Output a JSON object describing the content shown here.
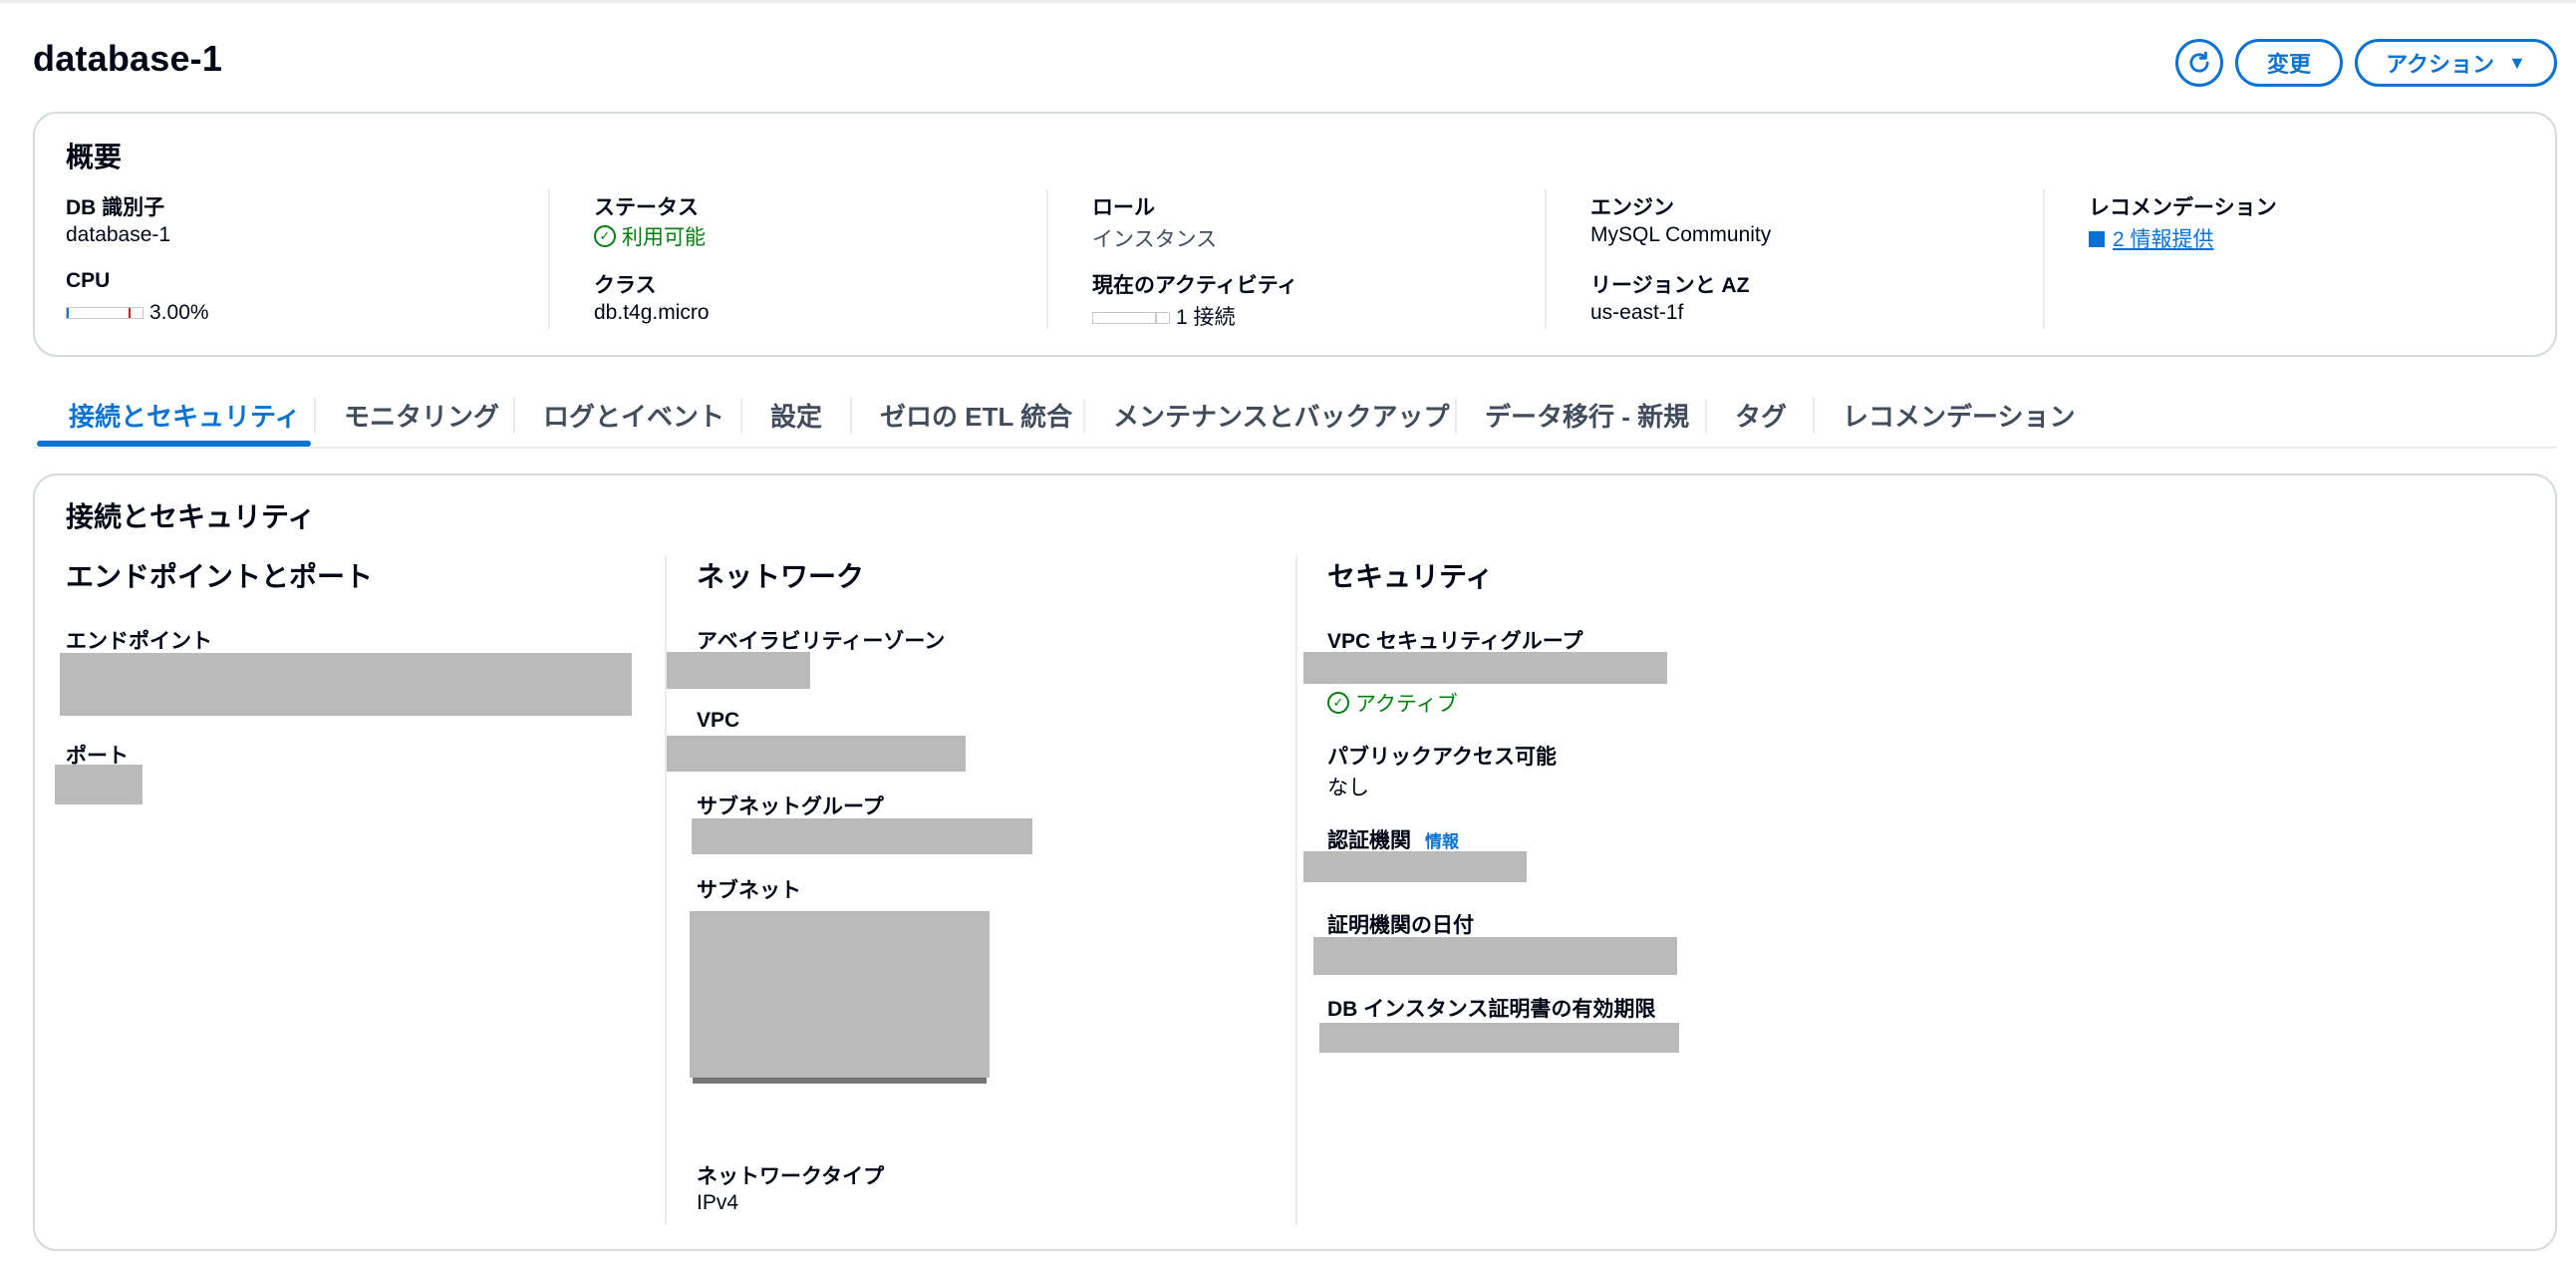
{
  "page": {
    "title": "database-1",
    "modify_label": "変更",
    "actions_label": "アクション",
    "refresh_icon": "refresh-icon"
  },
  "overview": {
    "title": "概要",
    "db_identifier": {
      "label": "DB 識別子",
      "value": "database-1"
    },
    "cpu": {
      "label": "CPU",
      "value": "3.00%",
      "percent": 3.0
    },
    "status": {
      "label": "ステータス",
      "value": "利用可能"
    },
    "class": {
      "label": "クラス",
      "value": "db.t4g.micro"
    },
    "role": {
      "label": "ロール",
      "value": "インスタンス"
    },
    "activity": {
      "label": "現在のアクティビティ",
      "value": "1 接続"
    },
    "engine": {
      "label": "エンジン",
      "value": "MySQL Community"
    },
    "region": {
      "label": "リージョンと AZ",
      "value": "us-east-1f"
    },
    "recommendations": {
      "label": "レコメンデーション",
      "value": "2 情報提供"
    }
  },
  "tabs": [
    {
      "label": "接続とセキュリティ",
      "active": true
    },
    {
      "label": "モニタリング"
    },
    {
      "label": "ログとイベント"
    },
    {
      "label": "設定"
    },
    {
      "label": "ゼロの ETL 統合"
    },
    {
      "label": "メンテナンスとバックアップ"
    },
    {
      "label": "データ移行 - 新規"
    },
    {
      "label": "タグ"
    },
    {
      "label": "レコメンデーション"
    }
  ],
  "connectivity": {
    "title": "接続とセキュリティ",
    "endpoints": {
      "title": "エンドポイントとポート",
      "endpoint_label": "エンドポイント",
      "port_label": "ポート"
    },
    "network": {
      "title": "ネットワーク",
      "az_label": "アベイラビリティーゾーン",
      "vpc_label": "VPC",
      "subnet_group_label": "サブネットグループ",
      "subnet_label": "サブネット",
      "network_type_label": "ネットワークタイプ",
      "network_type_value": "IPv4"
    },
    "security": {
      "title": "セキュリティ",
      "sg_label": "VPC セキュリティグループ",
      "sg_status": "アクティブ",
      "public_label": "パブリックアクセス可能",
      "public_value": "なし",
      "ca_label": "認証機関",
      "ca_info": "情報",
      "ca_date_label": "証明機関の日付",
      "cert_expiry_label": "DB インスタンス証明書の有効期限"
    }
  }
}
